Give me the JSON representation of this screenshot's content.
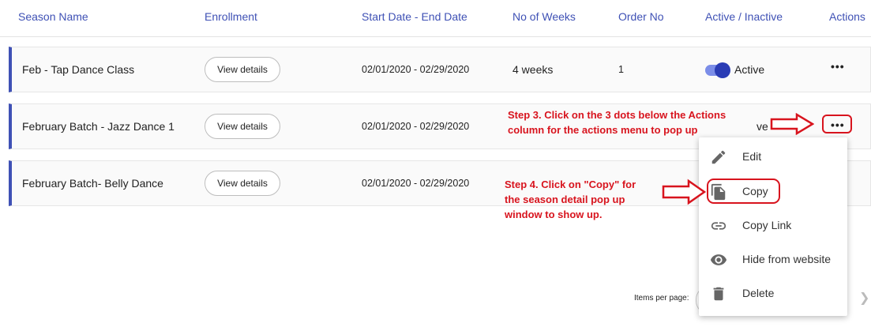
{
  "headers": {
    "season_name": "Season Name",
    "enrollment": "Enrollment",
    "dates": "Start Date - End Date",
    "weeks": "No of Weeks",
    "order": "Order No",
    "active": "Active / Inactive",
    "actions": "Actions"
  },
  "rows": [
    {
      "name": "Feb - Tap Dance Class",
      "enrollment_btn": "View details",
      "dates": "02/01/2020 - 02/29/2020",
      "weeks": "4 weeks",
      "order": "1",
      "status": "Active"
    },
    {
      "name": "February Batch - Jazz Dance 1",
      "enrollment_btn": "View details",
      "dates": "02/01/2020 - 02/29/2020",
      "status_partial": "ve"
    },
    {
      "name": "February Batch- Belly Dance",
      "enrollment_btn": "View details",
      "dates": "02/01/2020 - 02/29/2020"
    }
  ],
  "actions_icon": "more-horizontal-dots",
  "menu": {
    "items": [
      {
        "label": "Edit",
        "icon": "pencil-icon"
      },
      {
        "label": "Copy",
        "icon": "copy-icon"
      },
      {
        "label": "Copy Link",
        "icon": "link-icon"
      },
      {
        "label": "Hide from website",
        "icon": "eye-icon"
      },
      {
        "label": "Delete",
        "icon": "trash-icon"
      }
    ]
  },
  "annotations": {
    "step3": [
      "Step 3. Click on the 3 dots below the Actions",
      "column for the actions menu to pop up"
    ],
    "step4": [
      "Step 4. Click on \"Copy\" for",
      "the season detail pop up",
      "window to show up."
    ]
  },
  "pagination": {
    "items_per_page_label": "Items per page:"
  },
  "colors": {
    "accent": "#3f51b5",
    "annotation": "#d8141e",
    "toggle_knob": "#2a3cb5",
    "toggle_track": "#7b8de8"
  }
}
